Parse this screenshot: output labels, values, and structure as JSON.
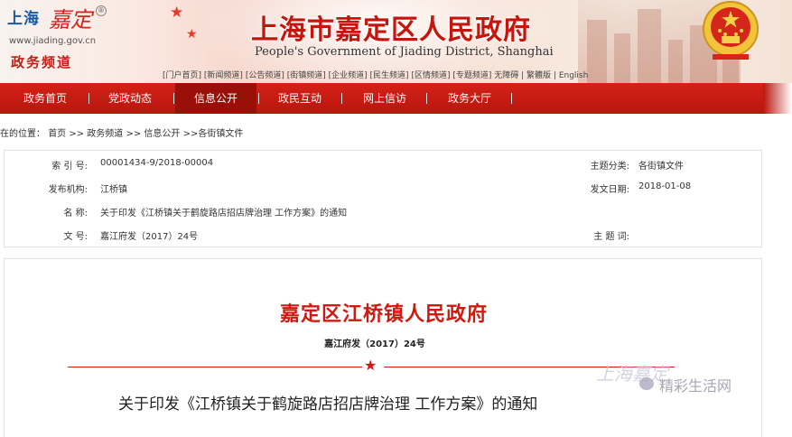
{
  "header": {
    "logo_city": "上海",
    "logo_script": "嘉定",
    "logo_mark": "®",
    "logo_url": "www.jiading.gov.cn",
    "channel": "政务频道",
    "title": "上海市嘉定区人民政府",
    "subtitle": "People's Government of Jiading District, Shanghai",
    "quick_links": [
      "[门户首页]",
      "[新闻频道]",
      "[公告频道]",
      "[街镇频道]",
      "[企业频道]",
      "[民生频道]",
      "[区情频道]",
      "[专题频道]",
      "无障碍",
      "| 繁體版",
      "| English"
    ]
  },
  "nav": {
    "items": [
      "政务首页",
      "党政动态",
      "信息公开",
      "政民互动",
      "网上信访",
      "政务大厅"
    ],
    "active_index": 2
  },
  "breadcrumb": {
    "prefix": "在的位置：",
    "items": [
      "首页",
      ">> 政务频道",
      ">> 信息公开",
      ">>各街镇文件"
    ]
  },
  "info": {
    "index_label": "索 引 号:",
    "index_value": "00001434-9/2018-00004",
    "topic_label": "主题分类:",
    "topic_value": "各街镇文件",
    "publisher_label": "发布机构:",
    "publisher_value": "江桥镇",
    "date_label": "发文日期:",
    "date_value": "2018-01-08",
    "name_label": "名    称:",
    "name_value": "关于印发《江桥镇关于鹤旋路店招店牌治理 工作方案》的通知",
    "doc_no_label": "文    号:",
    "doc_no_value": "嘉江府发（2017）24号",
    "keywords_label": "主 题 词:",
    "keywords_value": ""
  },
  "document": {
    "issuer": "嘉定区江桥镇人民政府",
    "number": "嘉江府发（2017）24号",
    "star": "★",
    "heading": "关于印发《江桥镇关于鹤旋路店招店牌治理  工作方案》的通知"
  },
  "watermark": {
    "script": "上海嘉定",
    "text": "精彩生活网"
  },
  "colors": {
    "brand_red": "#c5150d",
    "nav_red": "#d42117",
    "nav_active": "#9a0f08",
    "logo_blue": "#1b5aa6"
  }
}
